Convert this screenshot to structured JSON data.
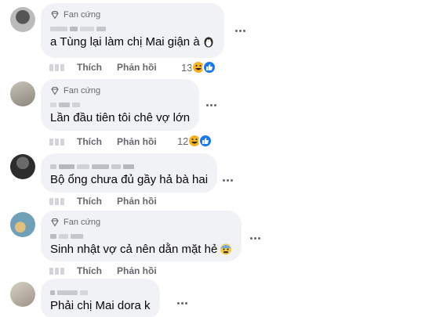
{
  "labels": {
    "fan_badge": "Fan cứng",
    "like": "Thích",
    "reply": "Phản hồi"
  },
  "colors": {
    "bubble": "#f0f2f5",
    "muted_text": "#65676b",
    "like_blue": "#1877f2",
    "haha_yellow": "#f7b125"
  },
  "comments": [
    {
      "fan": true,
      "text": "a Tùng lại làm chị Mai giận à",
      "inline_emoji": "penguin-emoji",
      "reaction_count": "13",
      "reaction_icons": [
        "haha-icon",
        "like-icon"
      ]
    },
    {
      "fan": true,
      "text": "Lần đầu tiên tôi chê vợ lớn",
      "inline_emoji": null,
      "reaction_count": "12",
      "reaction_icons": [
        "haha-icon",
        "like-icon"
      ]
    },
    {
      "fan": false,
      "text": "Bộ ổng chưa đủ gầy hả bà hai",
      "inline_emoji": null,
      "reaction_count": "",
      "reaction_icons": []
    },
    {
      "fan": true,
      "text": "Sinh nhật vợ cả nên dằn mặt hẻ",
      "inline_emoji": "cold-sweat-emoji",
      "reaction_count": "",
      "reaction_icons": []
    },
    {
      "fan": false,
      "text": "Phải chị Mai dora k",
      "inline_emoji": null,
      "reaction_count": "",
      "reaction_icons": []
    }
  ]
}
